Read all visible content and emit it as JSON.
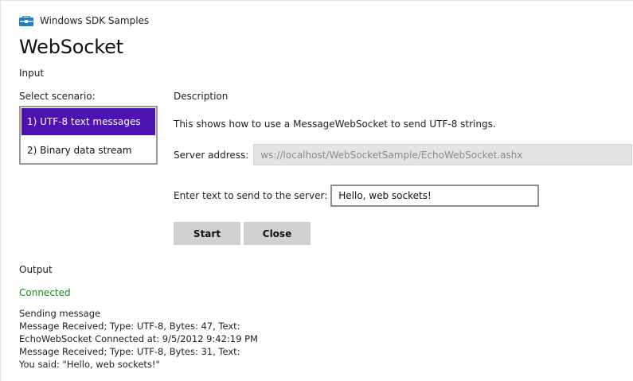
{
  "app": {
    "name": "Windows SDK Samples",
    "title": "WebSocket",
    "icon": "sdk-samples-icon"
  },
  "input": {
    "heading": "Input",
    "select_label": "Select scenario:",
    "scenarios": [
      {
        "label": "1) UTF-8 text messages",
        "selected": true
      },
      {
        "label": "2) Binary data stream",
        "selected": false
      }
    ]
  },
  "description": {
    "heading": "Description",
    "text": "This shows how to use a MessageWebSocket to send UTF-8 strings.",
    "server_label": "Server address:",
    "server_value": "ws://localhost/WebSocketSample/EchoWebSocket.ashx",
    "send_label": "Enter text to send to the server:",
    "send_value": "Hello, web sockets!",
    "start_label": "Start",
    "close_label": "Close"
  },
  "output": {
    "heading": "Output",
    "status": "Connected",
    "lines": [
      "Sending message",
      "Message Received; Type: UTF-8, Bytes: 47, Text:",
      "EchoWebSocket Connected at: 9/5/2012 9:42:19 PM",
      "Message Received; Type: UTF-8, Bytes: 31, Text:",
      "You said: \"Hello, web sockets!\""
    ]
  },
  "colors": {
    "selected": "#4d12b3",
    "status_connected": "#1d8a1d",
    "button": "#d1d1d1"
  }
}
